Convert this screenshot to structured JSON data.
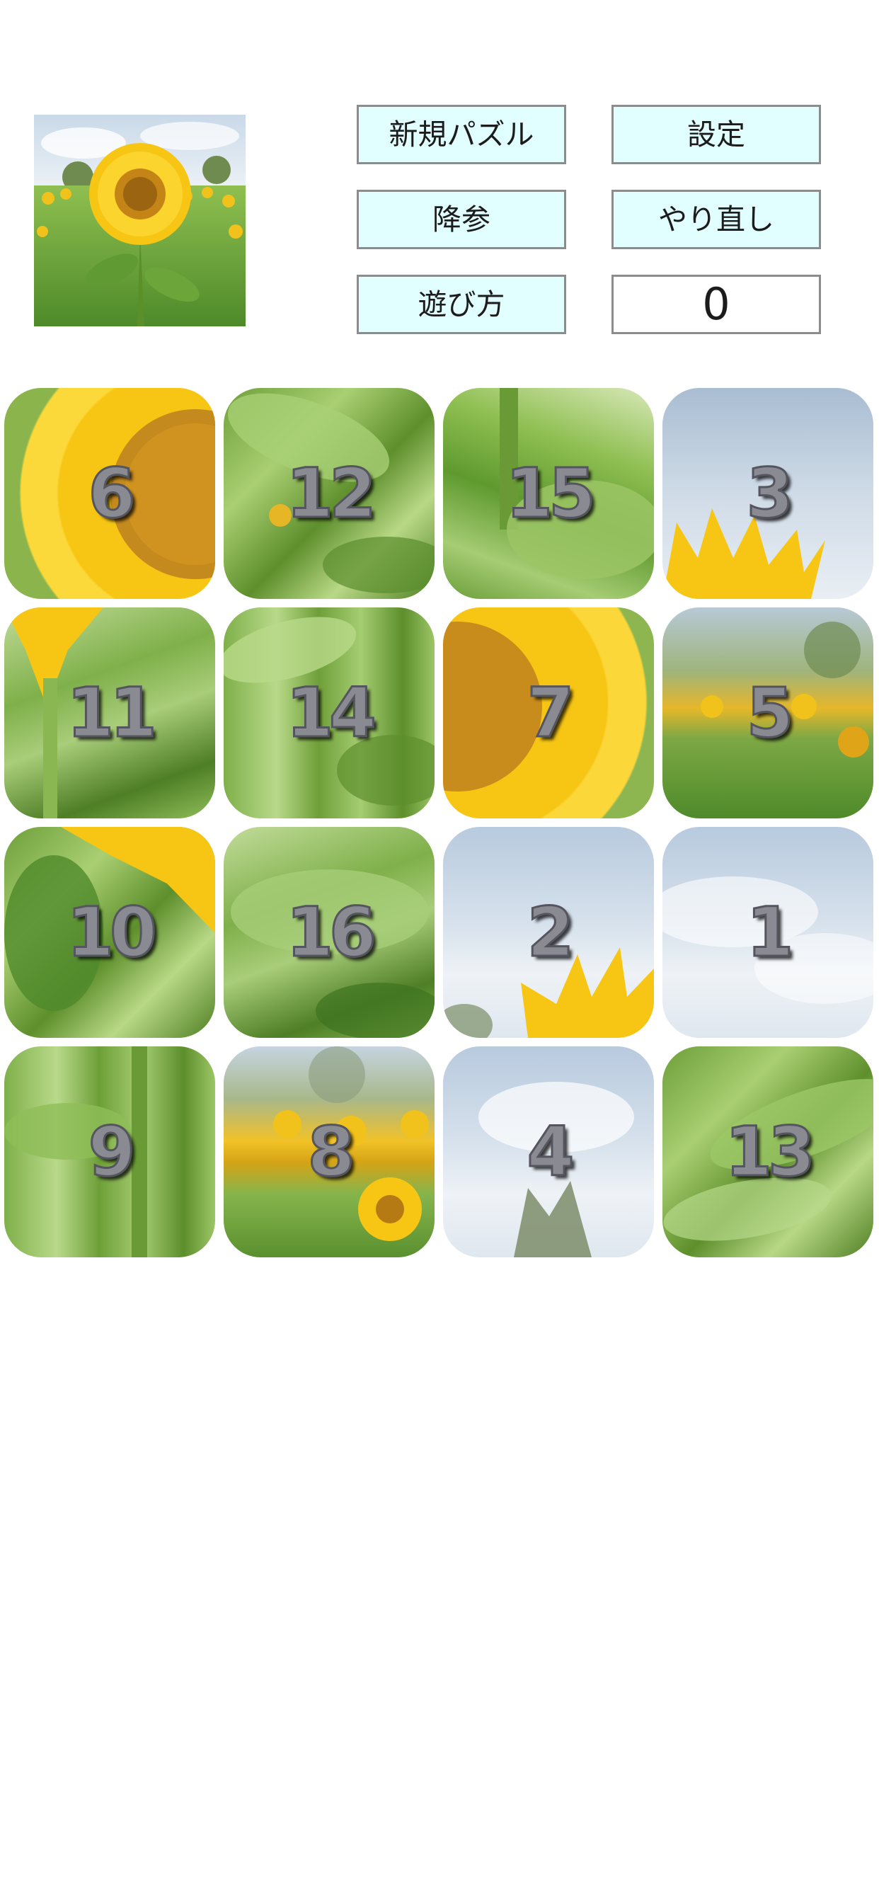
{
  "header": {
    "buttons": {
      "new_puzzle": "新規パズル",
      "settings": "設定",
      "give_up": "降参",
      "redo": "やり直し",
      "how_to_play": "遊び方"
    },
    "move_count": "0"
  },
  "board": {
    "tiles": [
      "6",
      "12",
      "15",
      "3",
      "11",
      "14",
      "7",
      "5",
      "10",
      "16",
      "2",
      "1",
      "9",
      "8",
      "4",
      "13"
    ]
  }
}
